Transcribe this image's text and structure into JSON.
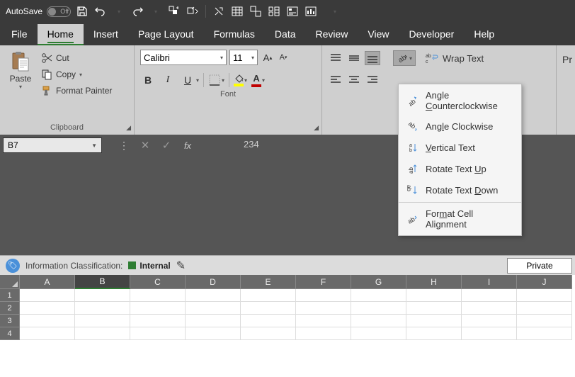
{
  "titlebar": {
    "autosave_label": "AutoSave",
    "autosave_state": "Off"
  },
  "tabs": {
    "file": "File",
    "home": "Home",
    "insert": "Insert",
    "page_layout": "Page Layout",
    "formulas": "Formulas",
    "data": "Data",
    "review": "Review",
    "view": "View",
    "developer": "Developer",
    "help": "Help"
  },
  "ribbon": {
    "clipboard": {
      "paste": "Paste",
      "cut": "Cut",
      "copy": "Copy",
      "format_painter": "Format Painter",
      "group_label": "Clipboard"
    },
    "font": {
      "name": "Calibri",
      "size": "11",
      "group_label": "Font"
    },
    "alignment": {
      "wrap_text": "Wrap Text",
      "group_label_partial": "Pr"
    }
  },
  "orientation_menu": {
    "ccw": "Angle Counterclockwise",
    "cw": "Angle Clockwise",
    "vertical": "Vertical Text",
    "up": "Rotate Text Up",
    "down": "Rotate Text Down",
    "format": "Format Cell Alignment"
  },
  "formula_bar": {
    "name_box": "B7",
    "formula_value": "234"
  },
  "classification": {
    "label": "Information Classification:",
    "value": "Internal",
    "private_btn": "Private"
  },
  "grid": {
    "columns": [
      "A",
      "B",
      "C",
      "D",
      "E",
      "F",
      "G",
      "H",
      "I",
      "J"
    ],
    "rows": [
      "1",
      "2",
      "3",
      "4"
    ]
  }
}
